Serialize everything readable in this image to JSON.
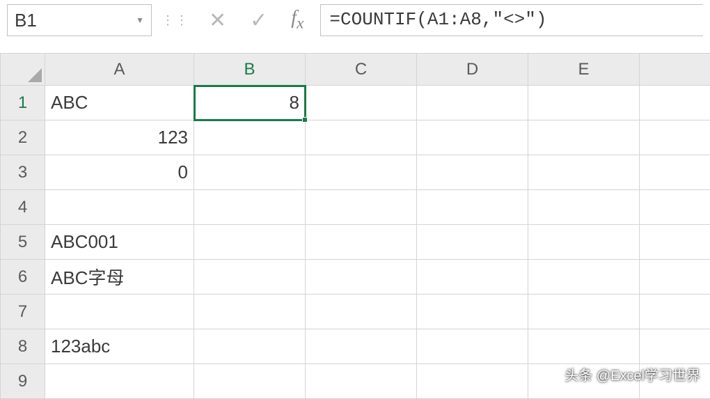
{
  "name_box": {
    "value": "B1"
  },
  "formula_bar": {
    "value": "=COUNTIF(A1:A8,\"<>\")"
  },
  "columns": [
    "A",
    "B",
    "C",
    "D",
    "E"
  ],
  "active": {
    "col": "B",
    "row": 1,
    "cell_ref": "B1"
  },
  "rows": [
    {
      "n": 1,
      "A": {
        "v": "ABC",
        "align": "left"
      },
      "B": {
        "v": "8",
        "align": "right",
        "selected": true
      }
    },
    {
      "n": 2,
      "A": {
        "v": "123",
        "align": "right"
      }
    },
    {
      "n": 3,
      "A": {
        "v": "0",
        "align": "right"
      }
    },
    {
      "n": 4
    },
    {
      "n": 5,
      "A": {
        "v": "ABC001",
        "align": "left"
      }
    },
    {
      "n": 6,
      "A": {
        "v": "ABC字母",
        "align": "left"
      }
    },
    {
      "n": 7
    },
    {
      "n": 8,
      "A": {
        "v": "123abc",
        "align": "left"
      }
    },
    {
      "n": 9
    }
  ],
  "watermark": "头条 @Excel学习世界",
  "chart_data": {
    "type": "table",
    "title": "Excel spreadsheet with COUNTIF formula",
    "columns": [
      "A",
      "B"
    ],
    "data": [
      [
        "ABC",
        8
      ],
      [
        123,
        null
      ],
      [
        0,
        null
      ],
      [
        null,
        null
      ],
      [
        "ABC001",
        null
      ],
      [
        "ABC字母",
        null
      ],
      [
        null,
        null
      ],
      [
        "123abc",
        null
      ]
    ],
    "formula_cell": "B1",
    "formula": "=COUNTIF(A1:A8,\"<>\")",
    "formula_result": 8
  }
}
